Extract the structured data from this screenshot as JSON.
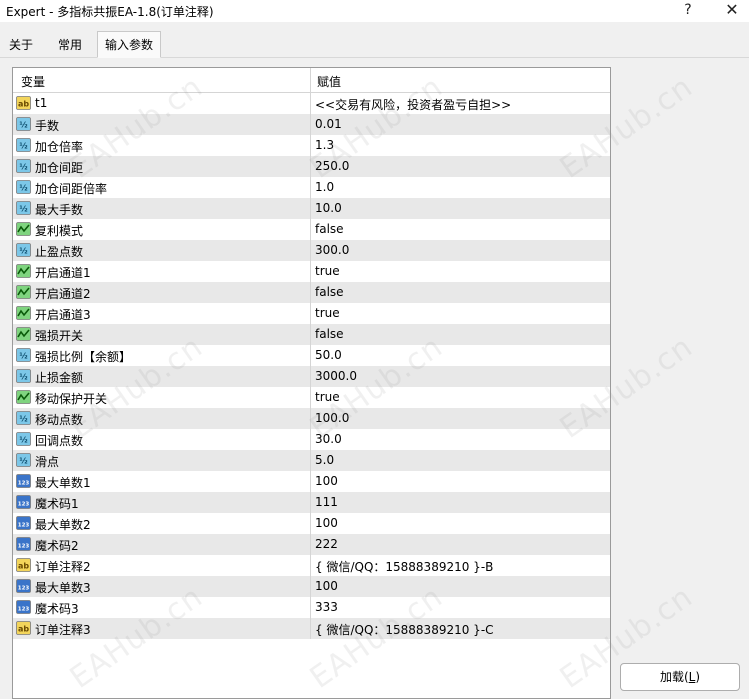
{
  "window": {
    "title": "Expert - 多指标共振EA-1.8(订单注释)",
    "help_label": "?",
    "close_label": "✕"
  },
  "tabs": [
    {
      "label": "关于"
    },
    {
      "label": "常用"
    },
    {
      "label": "输入参数"
    }
  ],
  "active_tab": "输入参数",
  "grid": {
    "header_variable": "变量",
    "header_value": "赋值",
    "rows": [
      {
        "name": "t1",
        "value": "<<交易有风险，投资者盈亏自担>>",
        "type": "string"
      },
      {
        "name": "手数",
        "value": "0.01",
        "type": "double"
      },
      {
        "name": "加仓倍率",
        "value": "1.3",
        "type": "double"
      },
      {
        "name": "加仓间距",
        "value": "250.0",
        "type": "double"
      },
      {
        "name": "加仓间距倍率",
        "value": "1.0",
        "type": "double"
      },
      {
        "name": "最大手数",
        "value": "10.0",
        "type": "double"
      },
      {
        "name": "复利模式",
        "value": "false",
        "type": "bool"
      },
      {
        "name": "止盈点数",
        "value": "300.0",
        "type": "double"
      },
      {
        "name": "开启通道1",
        "value": "true",
        "type": "bool"
      },
      {
        "name": "开启通道2",
        "value": "false",
        "type": "bool"
      },
      {
        "name": "开启通道3",
        "value": "true",
        "type": "bool"
      },
      {
        "name": "强损开关",
        "value": "false",
        "type": "bool"
      },
      {
        "name": "强损比例【余额】",
        "value": "50.0",
        "type": "double"
      },
      {
        "name": "止损金额",
        "value": "3000.0",
        "type": "double"
      },
      {
        "name": "移动保护开关",
        "value": "true",
        "type": "bool"
      },
      {
        "name": "移动点数",
        "value": "100.0",
        "type": "double"
      },
      {
        "name": "回调点数",
        "value": "30.0",
        "type": "double"
      },
      {
        "name": "滑点",
        "value": "5.0",
        "type": "double"
      },
      {
        "name": "最大单数1",
        "value": "100",
        "type": "int"
      },
      {
        "name": "魔术码1",
        "value": "111",
        "type": "int"
      },
      {
        "name": "最大单数2",
        "value": "100",
        "type": "int"
      },
      {
        "name": "魔术码2",
        "value": "222",
        "type": "int"
      },
      {
        "name": "订单注释2",
        "value": "{ 微信/QQ：15888389210 }-B",
        "type": "string"
      },
      {
        "name": "最大单数3",
        "value": "100",
        "type": "int"
      },
      {
        "name": "魔术码3",
        "value": "333",
        "type": "int"
      },
      {
        "name": "订单注释3",
        "value": "{ 微信/QQ：15888389210 }-C",
        "type": "string"
      }
    ]
  },
  "icons": {
    "string": {
      "name": "string-type-icon",
      "glyph": "ab",
      "bg": "#f3d55b",
      "fg": "#6a4a00"
    },
    "double": {
      "name": "double-type-icon",
      "glyph": "½",
      "bg": "#7cc7e8",
      "fg": "#0a4a6a"
    },
    "bool": {
      "name": "bool-type-icon",
      "glyph": "∿",
      "bg": "#7fd47f",
      "fg": "#0a5a0a"
    },
    "int": {
      "name": "int-type-icon",
      "glyph": "123",
      "bg": "#3a74c9",
      "fg": "#ffffff"
    }
  },
  "watermark": "EAHub.cn",
  "buttons": {
    "load_label": "加载(",
    "load_hotkey": "L",
    "load_suffix": ")"
  }
}
